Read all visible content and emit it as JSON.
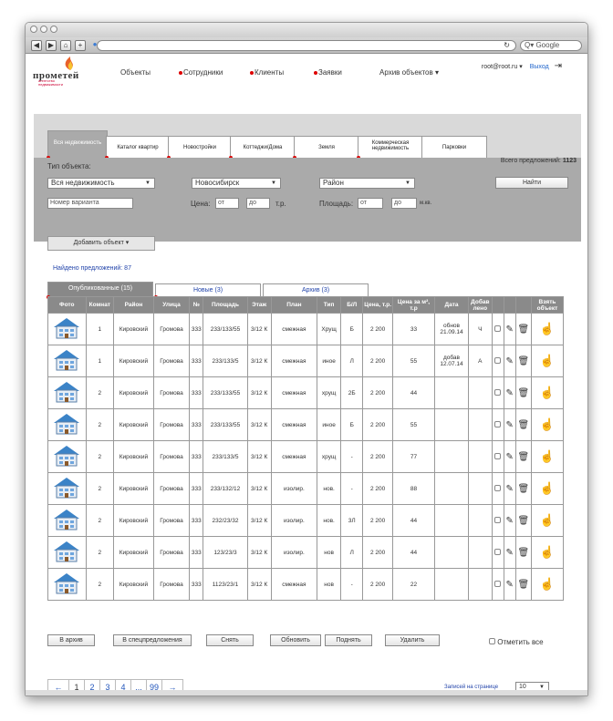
{
  "browser": {
    "search_placeholder": "Q▾ Google",
    "reload_icon": "reload-icon"
  },
  "logo": {
    "name": "прометей",
    "subtitle": "агентство недвижимости"
  },
  "nav": {
    "items": [
      "Объекты",
      "Сотрудники",
      "Клиенты",
      "Заявки",
      "Архив объектов"
    ]
  },
  "user": {
    "email": "root@root.ru",
    "logout": "Выход"
  },
  "search": {
    "tabs": [
      "Вся недвижимость",
      "Каталог квартир",
      "Новостройки",
      "Коттеджи/Дома",
      "Земля",
      "Коммерческая недвижимость",
      "Парковки"
    ],
    "object_type_label": "Тип объекта:",
    "total_label": "Всего предложений:",
    "total_value": "1123",
    "type_value": "Вся недвижимость",
    "city_value": "Новосибирск",
    "district_value": "Район",
    "find_button": "Найти",
    "variant_placeholder": "Номер варианта",
    "price_label": "Цена:",
    "from": "от",
    "to": "до",
    "price_unit": "т.р.",
    "area_label": "Площадь:",
    "area_unit": "м.кв."
  },
  "add_button": "Добавить объект",
  "found": "Найдено предложений: 87",
  "list_tabs": [
    "Опубликованные (15)",
    "Новые (3)",
    "Архив (3)"
  ],
  "table": {
    "headers": [
      "Фото",
      "Комнат",
      "Район",
      "Улица",
      "№",
      "Площадь",
      "Этаж",
      "План",
      "Тип",
      "Б/Л",
      "Цена, т.р.",
      "Цена за м², т.р",
      "Дата",
      "Добав лено",
      "",
      "",
      "",
      "Взять объект"
    ],
    "rows": [
      [
        "1",
        "Кировский",
        "Громова",
        "333",
        "233/133/55",
        "3/12 К",
        "смежная",
        "Хрущ",
        "Б",
        "2 200",
        "33",
        "обнов 21.09.14",
        "Ч"
      ],
      [
        "1",
        "Кировский",
        "Громова",
        "333",
        "233/133/5",
        "3/12 К",
        "смежная",
        "иное",
        "Л",
        "2 200",
        "55",
        "добав 12.07.14",
        "А"
      ],
      [
        "2",
        "Кировский",
        "Громова",
        "333",
        "233/133/55",
        "3/12 К",
        "смежная",
        "хрущ",
        "2Б",
        "2 200",
        "44",
        "",
        ""
      ],
      [
        "2",
        "Кировский",
        "Громова",
        "333",
        "233/133/55",
        "3/12 К",
        "смежная",
        "иное",
        "Б",
        "2 200",
        "55",
        "",
        ""
      ],
      [
        "2",
        "Кировский",
        "Громова",
        "333",
        "233/133/5",
        "3/12 К",
        "смежная",
        "хрущ",
        "-",
        "2 200",
        "77",
        "",
        ""
      ],
      [
        "2",
        "Кировский",
        "Громова",
        "333",
        "233/132/12",
        "3/12 К",
        "изолир.",
        "нов.",
        "-",
        "2 200",
        "88",
        "",
        ""
      ],
      [
        "2",
        "Кировский",
        "Громова",
        "333",
        "232/23/32",
        "3/12 К",
        "изолир.",
        "нов.",
        "3Л",
        "2 200",
        "44",
        "",
        ""
      ],
      [
        "2",
        "Кировский",
        "Громова",
        "333",
        "123/23/3",
        "3/12 К",
        "изолир.",
        "нов",
        "Л",
        "2 200",
        "44",
        "",
        ""
      ],
      [
        "2",
        "Кировский",
        "Громова",
        "333",
        "1123/23/1",
        "3/12 К",
        "смежная",
        "нов",
        "-",
        "2 200",
        "22",
        "",
        ""
      ]
    ]
  },
  "actions": [
    "В архив",
    "В спецпредложения",
    "Снять",
    "Обновить",
    "Поднять",
    "Удалить"
  ],
  "mark_all": "Отметить все",
  "pagination": [
    "←",
    "1",
    "2",
    "3",
    "4",
    "...",
    "99",
    "→"
  ],
  "per_page_label": "Записей на странице",
  "per_page_value": "10"
}
